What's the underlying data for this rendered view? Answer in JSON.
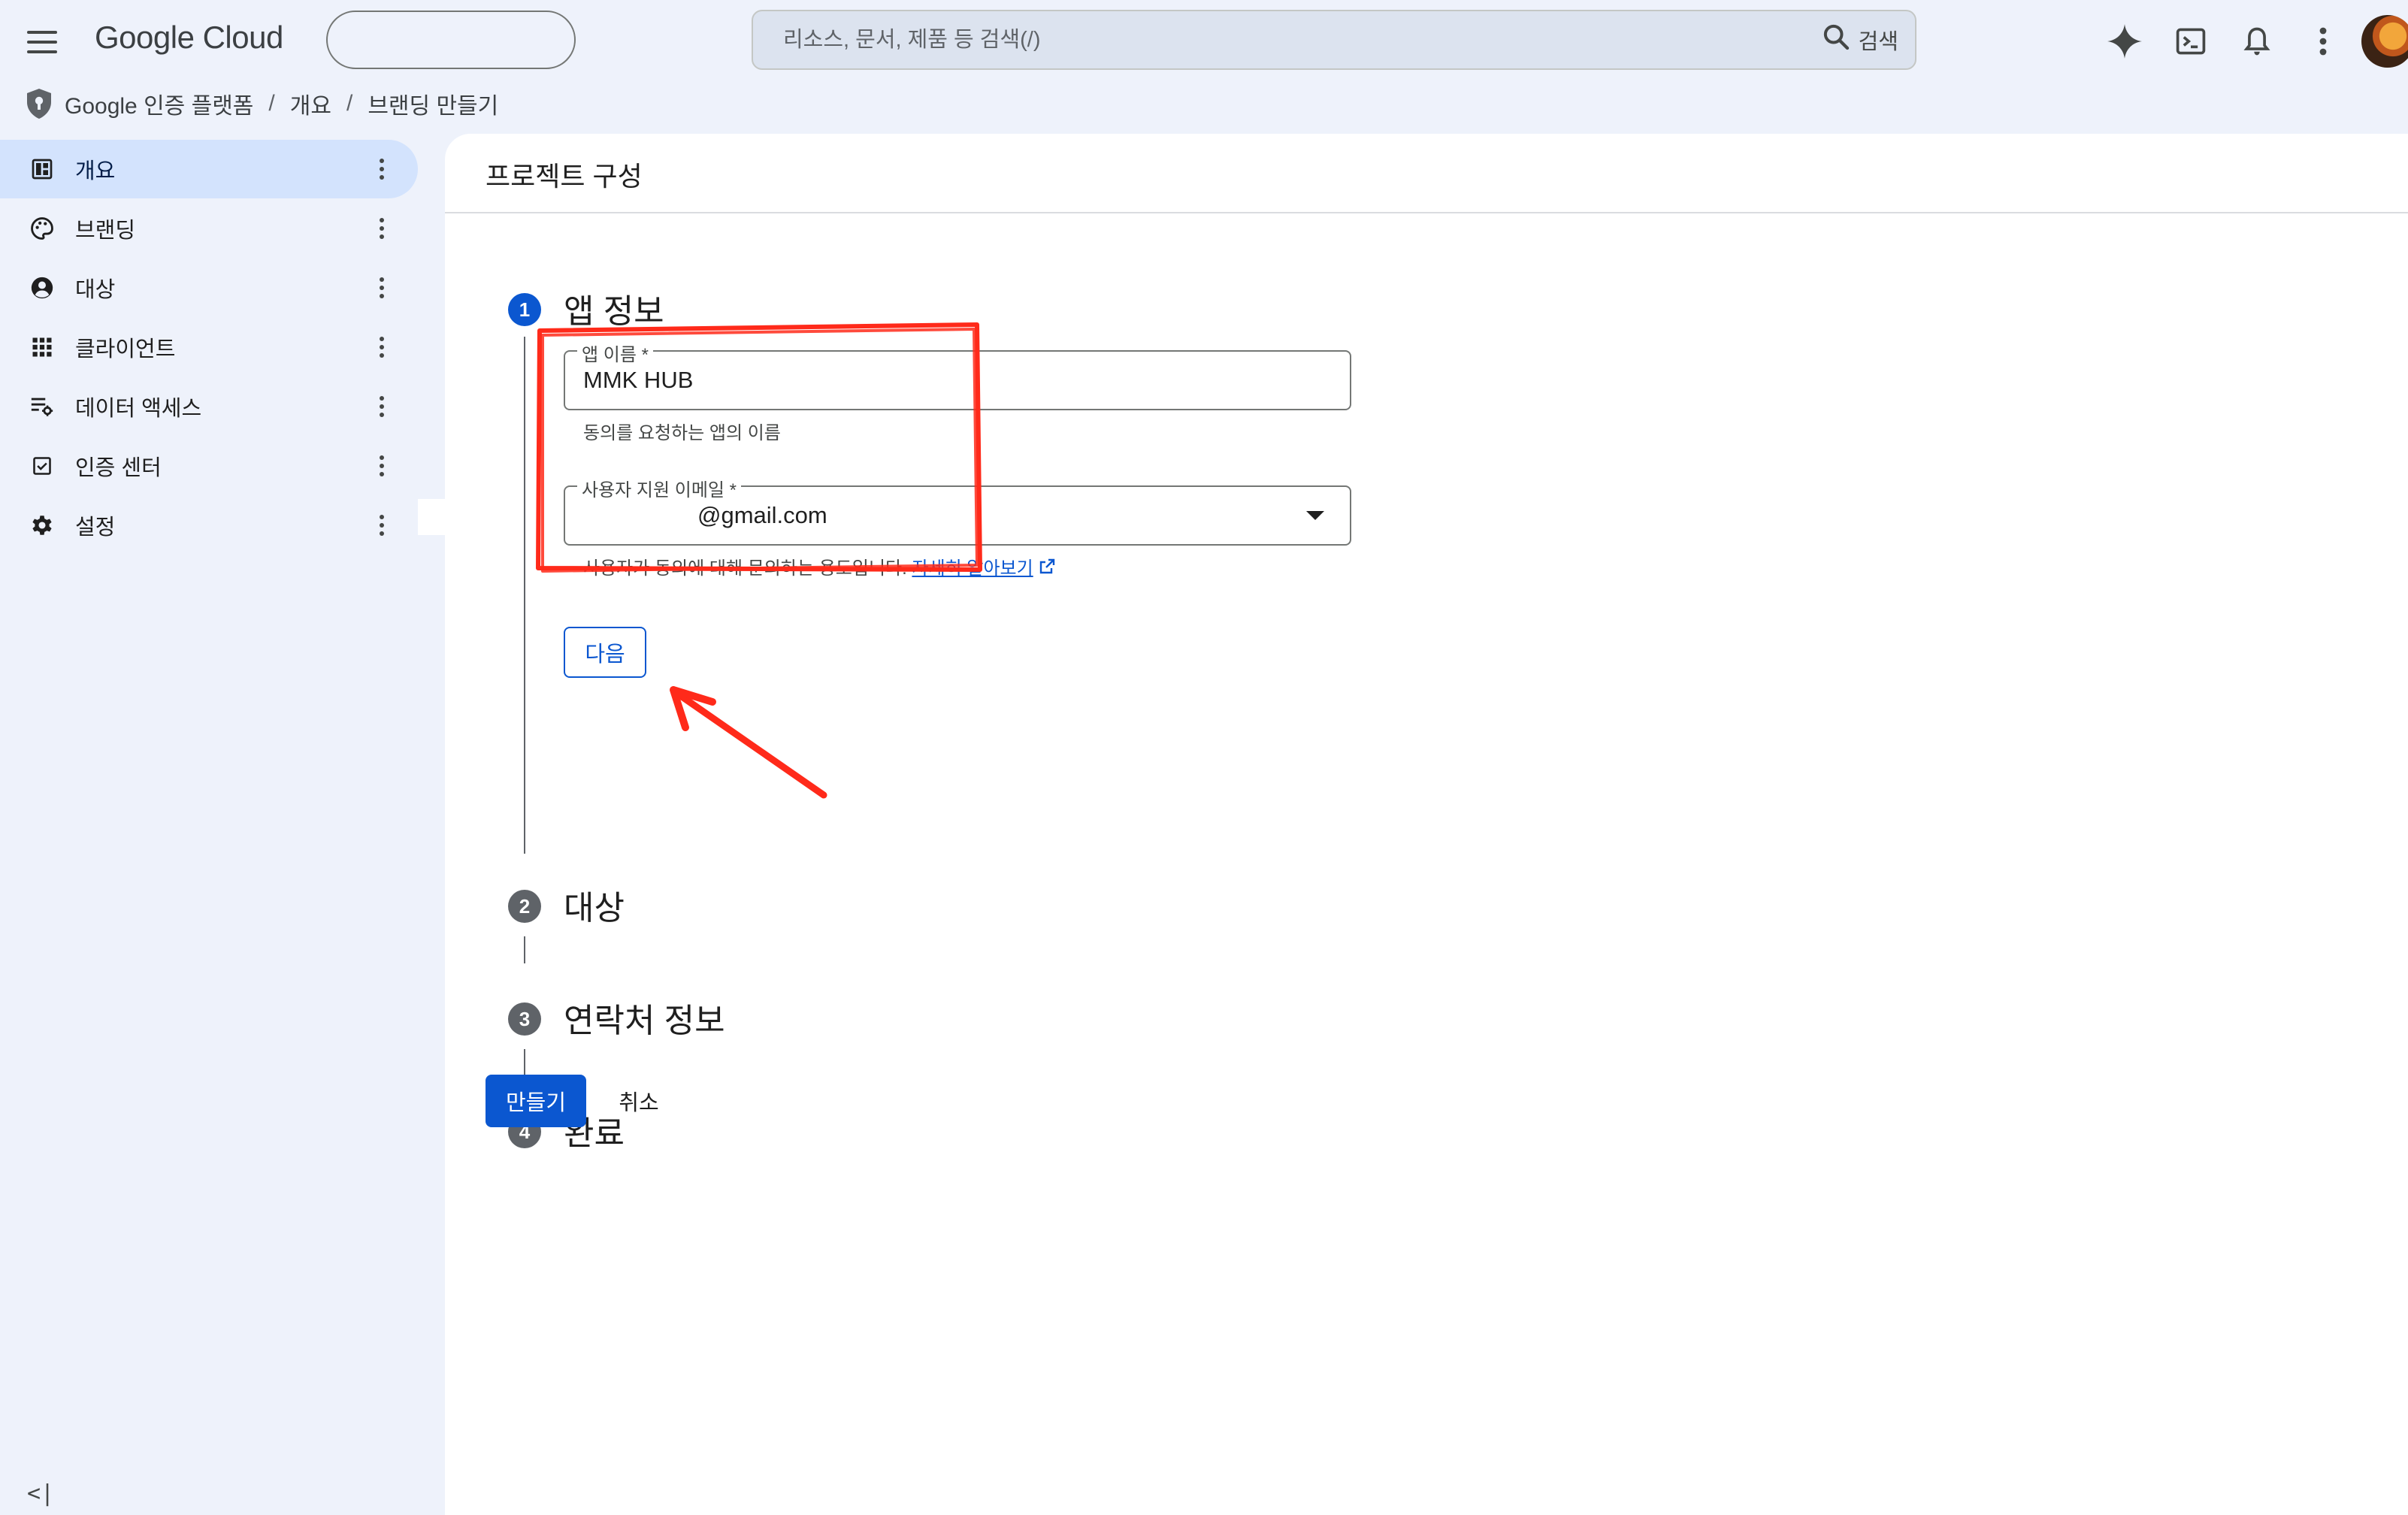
{
  "header": {
    "brand": "Google Cloud",
    "search_placeholder": "리소스, 문서, 제품 등 검색(/)",
    "search_button": "검색",
    "icons": [
      "menu-icon",
      "gemini-spark-icon",
      "cloud-shell-icon",
      "notifications-icon",
      "more-vert-icon"
    ]
  },
  "breadcrumb": {
    "product": "Google 인증 플랫폼",
    "items": [
      "개요",
      "브랜딩 만들기"
    ]
  },
  "sidebar": {
    "items": [
      {
        "label": "개요",
        "icon": "dashboard-icon",
        "active": true
      },
      {
        "label": "브랜딩",
        "icon": "palette-icon",
        "active": false
      },
      {
        "label": "대상",
        "icon": "account-circle-icon",
        "active": false
      },
      {
        "label": "클라이언트",
        "icon": "apps-grid-icon",
        "active": false
      },
      {
        "label": "데이터 액세스",
        "icon": "data-access-icon",
        "active": false
      },
      {
        "label": "인증 센터",
        "icon": "check-box-icon",
        "active": false
      },
      {
        "label": "설정",
        "icon": "gear-icon",
        "active": false
      }
    ],
    "collapse_label": "<|"
  },
  "main": {
    "title": "프로젝트 구성",
    "steps": [
      {
        "number": "1",
        "label": "앱 정보",
        "active": true
      },
      {
        "number": "2",
        "label": "대상",
        "active": false
      },
      {
        "number": "3",
        "label": "연락처 정보",
        "active": false
      },
      {
        "number": "4",
        "label": "완료",
        "active": false
      }
    ],
    "app_name": {
      "label": "앱 이름 *",
      "value": "MMK HUB",
      "hint": "동의를 요청하는 앱의 이름"
    },
    "support_email": {
      "label": "사용자 지원 이메일 *",
      "value": "@gmail.com",
      "hint": "사용자가 동의에 대해 문의하는 용도입니다.",
      "learn_more": "자세히 알아보기"
    },
    "next_button": "다음",
    "create_button": "만들기",
    "cancel_button": "취소"
  },
  "colors": {
    "accent": "#0b57d0",
    "active_nav": "#d3e3fd",
    "annotation": "#ff2a1a"
  }
}
